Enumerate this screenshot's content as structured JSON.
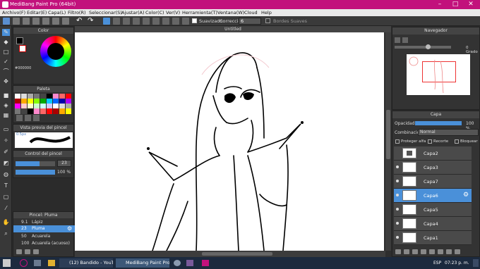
{
  "titlebar": {
    "title": "MediBang Paint Pro (64bit)"
  },
  "menu": [
    "Archivo(F)",
    "Editar(E)",
    "Capa(L)",
    "Filtro(R)",
    "Seleccionar(S)",
    "Ajustar(A)",
    "Color(C)",
    "Ver(V)",
    "Herramienta(T)",
    "Ventana(W)",
    "Cloud",
    "Help"
  ],
  "toolbar": {
    "antialias_label": "Suavizado",
    "correction_label": "Corrección",
    "correction_value": "6",
    "soft_edges_label": "Bordes Suaves"
  },
  "color_panel": {
    "title": "Color",
    "hex": "#000000"
  },
  "palette_panel": {
    "title": "Paleta"
  },
  "brush_preview_panel": {
    "title": "Vista previa del pincel",
    "size": "0.5px"
  },
  "brush_control": {
    "title": "Control del pincel",
    "size": "23",
    "opacity": "100 %"
  },
  "brush_list": {
    "title": "Pincel: Pluma",
    "items": [
      {
        "size": "9.1",
        "name": "Lápiz"
      },
      {
        "size": "23",
        "name": "Pluma"
      },
      {
        "size": "50",
        "name": "Acuarela"
      },
      {
        "size": "100",
        "name": "Acuarela (acuoso)"
      }
    ],
    "selected": 1
  },
  "canvas": {
    "doc_title": "Untitled"
  },
  "navigator": {
    "title": "Navegador",
    "angle": "0 Grado"
  },
  "layers": {
    "title": "Capa",
    "opacity_label": "Opacidad",
    "opacity_value": "100 %",
    "blend_label": "Combinación",
    "blend_value": "Normal",
    "protect_alpha": "Proteger alfa",
    "clipping": "Recorte",
    "lock": "Bloquear",
    "items": [
      "Capa2",
      "Capa3",
      "Capa7",
      "Capa6",
      "Capa5",
      "Capa4",
      "Capa1"
    ],
    "selected": 3
  },
  "taskbar": {
    "tasks": [
      "(12) Bandido - YouTu...",
      "MediBang Paint Pro (..."
    ],
    "lang": "ESP",
    "time": "07:23 p. m."
  },
  "colors": {
    "accent": "#c2117c",
    "selected": "#4a90d9"
  }
}
